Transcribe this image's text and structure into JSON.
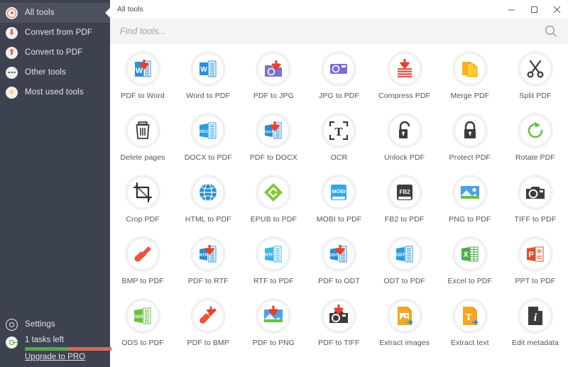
{
  "sidebar": {
    "items": [
      {
        "label": "All tools",
        "icon": "target-icon",
        "active": true
      },
      {
        "label": "Convert from PDF",
        "icon": "arrow-down-icon",
        "active": false
      },
      {
        "label": "Convert to PDF",
        "icon": "arrow-up-icon",
        "active": false
      },
      {
        "label": "Other tools",
        "icon": "ellipsis-icon",
        "active": false
      },
      {
        "label": "Most used tools",
        "icon": "star-icon",
        "active": false
      }
    ],
    "settings_label": "Settings",
    "tasks_label": "1 tasks left",
    "upgrade_label": "Upgrade to PRO",
    "progress_green_pct": 50,
    "progress_red_pct": 50,
    "colors": {
      "background": "#3c4250",
      "active_background": "#4b515f",
      "text": "#e3e5e8",
      "progress_green": "#5ba34f",
      "progress_red": "#d9695e"
    }
  },
  "titlebar": {
    "title": "All tools",
    "minimize_label": "Minimize",
    "maximize_label": "Maximize",
    "close_label": "Close"
  },
  "search": {
    "value": "",
    "placeholder": "Find tools...",
    "icon": "search-icon"
  },
  "tools": [
    {
      "label": "PDF to Word",
      "icon": "pdf-to-word-icon"
    },
    {
      "label": "Word to PDF",
      "icon": "word-to-pdf-icon"
    },
    {
      "label": "PDF to JPG",
      "icon": "pdf-to-jpg-icon"
    },
    {
      "label": "JPG to PDF",
      "icon": "jpg-to-pdf-icon"
    },
    {
      "label": "Compress PDF",
      "icon": "compress-pdf-icon"
    },
    {
      "label": "Merge PDF",
      "icon": "merge-pdf-icon"
    },
    {
      "label": "Split PDF",
      "icon": "split-pdf-icon"
    },
    {
      "label": "Delete pages",
      "icon": "trash-icon"
    },
    {
      "label": "DOCX to PDF",
      "icon": "docx-to-pdf-icon"
    },
    {
      "label": "PDF to DOCX",
      "icon": "pdf-to-docx-icon"
    },
    {
      "label": "OCR",
      "icon": "ocr-icon"
    },
    {
      "label": "Unlock PDF",
      "icon": "unlock-icon"
    },
    {
      "label": "Protect PDF",
      "icon": "lock-icon"
    },
    {
      "label": "Rotate PDF",
      "icon": "rotate-icon"
    },
    {
      "label": "Crop PDF",
      "icon": "crop-icon"
    },
    {
      "label": "HTML to PDF",
      "icon": "globe-icon"
    },
    {
      "label": "EPUB to PDF",
      "icon": "epub-icon"
    },
    {
      "label": "MOBI to PDF",
      "icon": "mobi-icon"
    },
    {
      "label": "FB2 to PDF",
      "icon": "fb2-icon"
    },
    {
      "label": "PNG to PDF",
      "icon": "png-to-pdf-icon"
    },
    {
      "label": "TIFF to PDF",
      "icon": "camera-icon"
    },
    {
      "label": "BMP to PDF",
      "icon": "paintbrush-icon"
    },
    {
      "label": "PDF to RTF",
      "icon": "pdf-to-rtf-icon"
    },
    {
      "label": "RTF to PDF",
      "icon": "rtf-to-pdf-icon"
    },
    {
      "label": "PDF to ODT",
      "icon": "pdf-to-odt-icon"
    },
    {
      "label": "ODT to PDF",
      "icon": "odt-to-pdf-icon"
    },
    {
      "label": "Excel to PDF",
      "icon": "excel-icon"
    },
    {
      "label": "PPT to PDF",
      "icon": "powerpoint-icon"
    },
    {
      "label": "ODS to PDF",
      "icon": "ods-icon"
    },
    {
      "label": "PDF to BMP",
      "icon": "pdf-to-bmp-icon"
    },
    {
      "label": "PDF to PNG",
      "icon": "pdf-to-png-icon"
    },
    {
      "label": "PDF to TIFF",
      "icon": "pdf-to-tiff-icon"
    },
    {
      "label": "Extract images",
      "icon": "extract-images-icon"
    },
    {
      "label": "Extract text",
      "icon": "extract-text-icon"
    },
    {
      "label": "Edit metadata",
      "icon": "edit-metadata-icon"
    }
  ]
}
